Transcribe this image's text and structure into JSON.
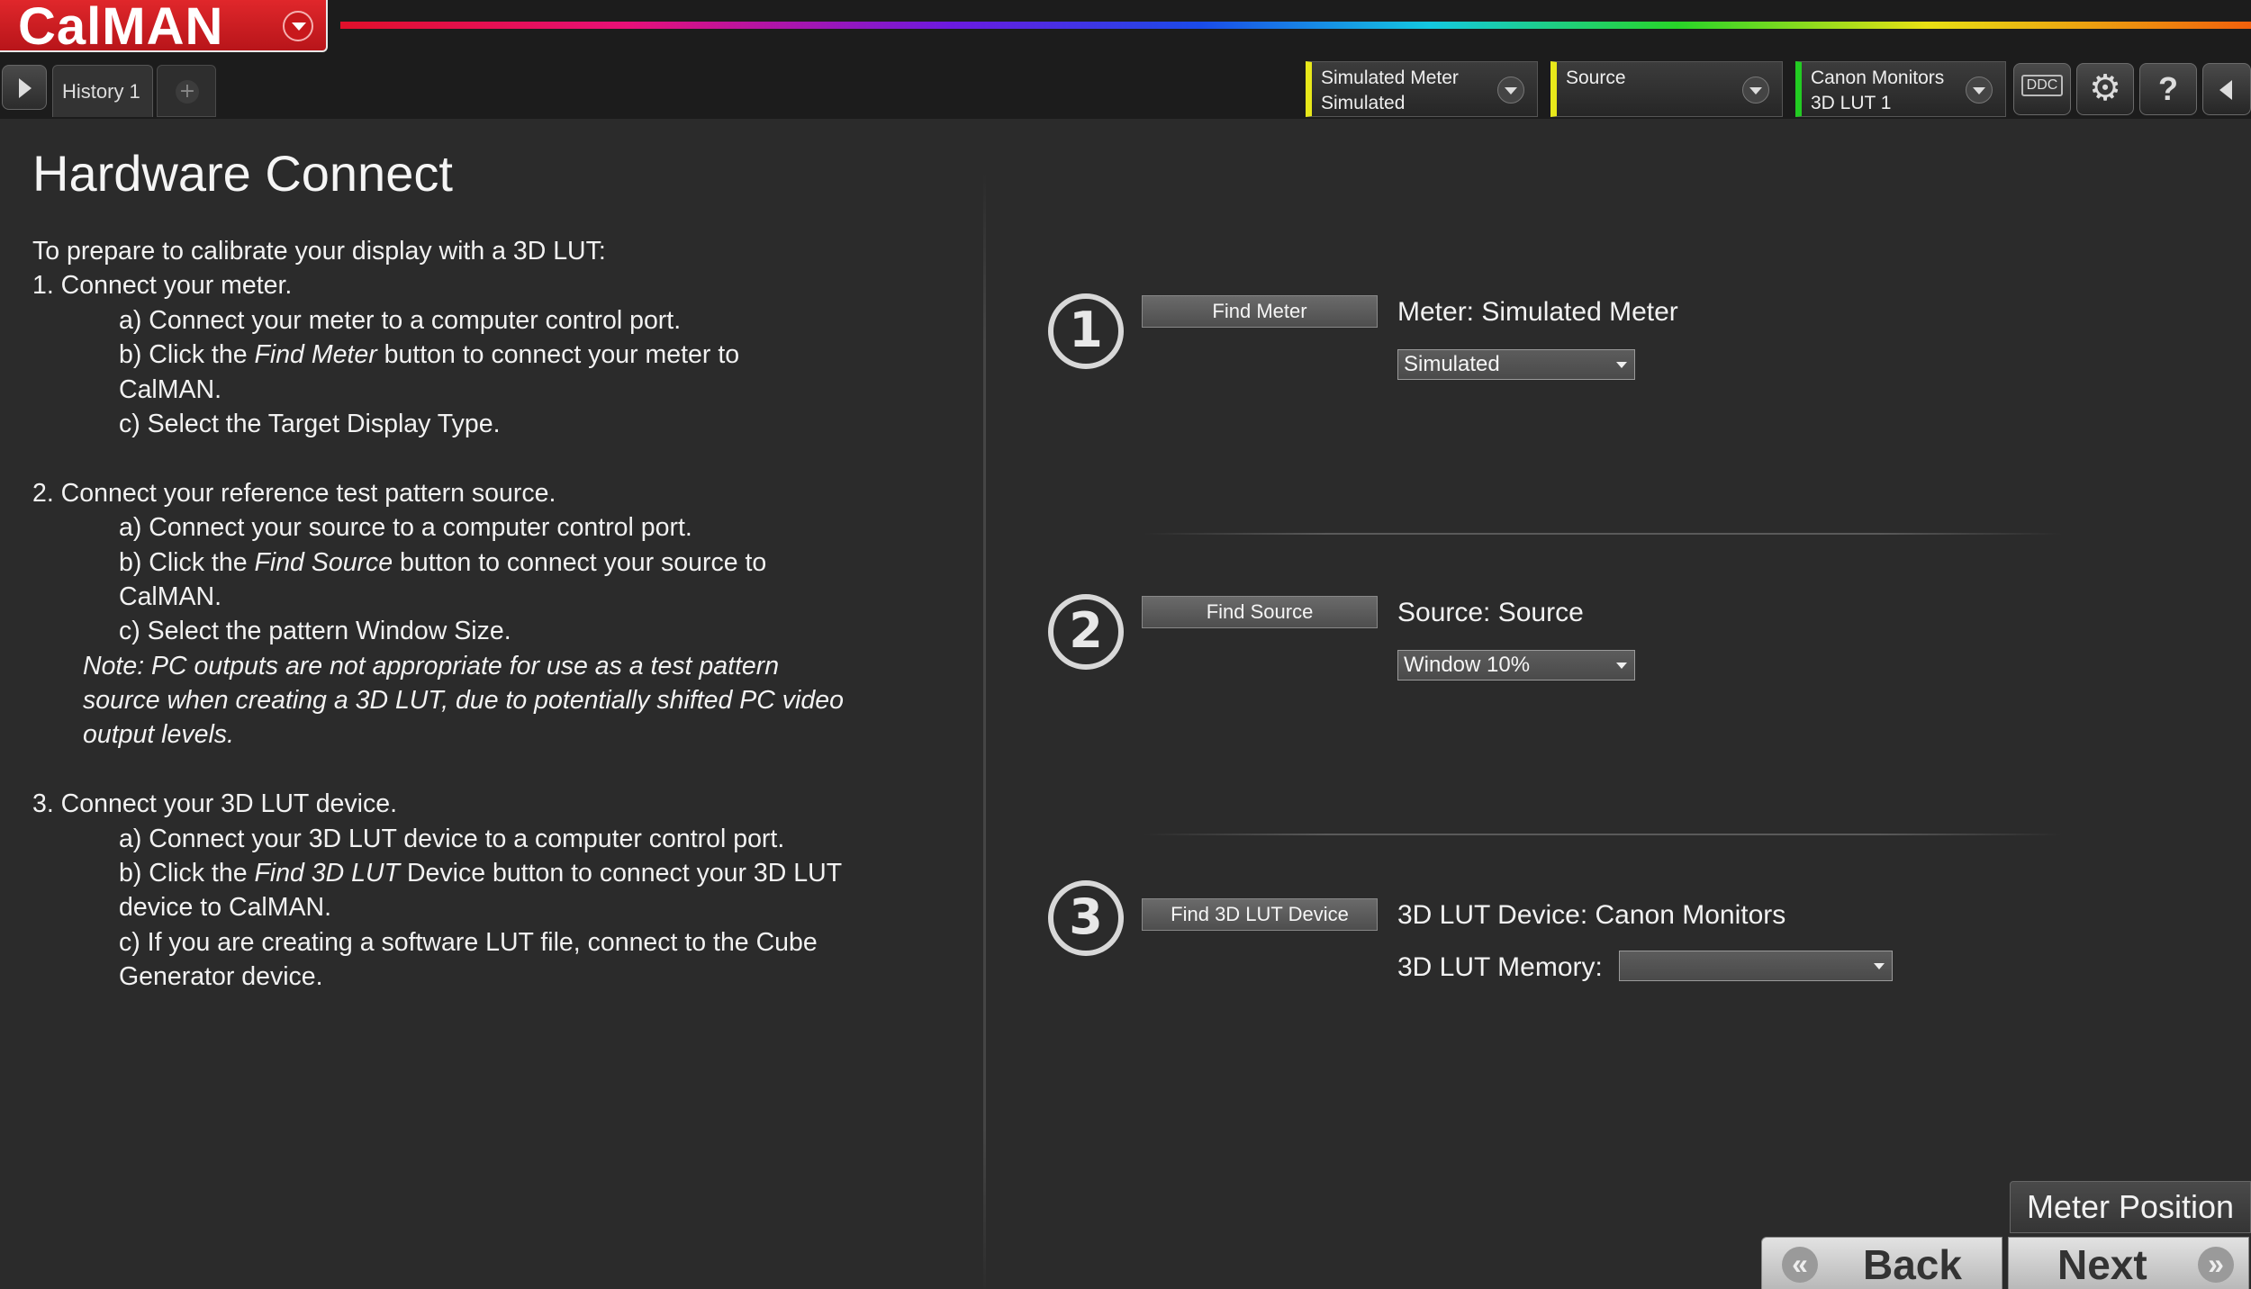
{
  "app": {
    "logo": "CalMAN"
  },
  "tabs": {
    "history": "History 1",
    "add": "+"
  },
  "devices": {
    "meter": {
      "line1": "Simulated Meter",
      "line2": "Simulated",
      "status_color": "#e8e81a"
    },
    "source": {
      "line1": "Source",
      "line2": "",
      "status_color": "#e8e81a"
    },
    "lut": {
      "line1": "Canon Monitors",
      "line2": "3D LUT 1",
      "status_color": "#22cc22"
    }
  },
  "toolbar": {
    "ddc": "DDC",
    "gear": "⚙",
    "help": "?"
  },
  "page": {
    "title": "Hardware Connect"
  },
  "instructions": {
    "intro": "To prepare to calibrate your display with a 3D LUT:",
    "s1": {
      "title": "1.  Connect your meter.",
      "a": "a)  Connect your meter to a computer control port.",
      "b_pre": "b)  Click the ",
      "b_em": "Find Meter",
      "b_post": " button to connect your meter to",
      "b_cont": "CalMAN.",
      "c": "c)  Select the Target Display Type."
    },
    "s2": {
      "title": "2.  Connect your reference test pattern source.",
      "a": "a)  Connect your source to a computer control port.",
      "b_pre": "b)  Click the ",
      "b_em": "Find Source",
      "b_post": " button to connect your source to",
      "b_cont": "CalMAN.",
      "c": "c)  Select the pattern Window Size.",
      "note1": "Note: PC outputs are not appropriate for use as a test pattern",
      "note2": "source when creating a 3D LUT, due to potentially shifted PC video",
      "note3": "output levels."
    },
    "s3": {
      "title": "3.  Connect your 3D LUT device.",
      "a": "a)  Connect your 3D LUT device to a computer control port.",
      "b_pre": "b)  Click the ",
      "b_em": "Find 3D LUT",
      "b_post": " Device button to connect your 3D LUT",
      "b_cont": "device to CalMAN.",
      "c1": "c)  If you are creating a software LUT file, connect to the Cube",
      "c2": "Generator device."
    }
  },
  "steps": {
    "meter": {
      "num": "1",
      "button": "Find Meter",
      "label": "Meter: Simulated Meter",
      "select": "Simulated"
    },
    "source": {
      "num": "2",
      "button": "Find Source",
      "label": "Source: Source",
      "select": "Window 10%"
    },
    "lut": {
      "num": "3",
      "button": "Find 3D LUT Device",
      "label": "3D LUT Device: Canon Monitors",
      "memory_label": "3D LUT Memory:",
      "memory_select": ""
    }
  },
  "nav": {
    "meter_position": "Meter Position",
    "back": "Back",
    "next": "Next",
    "back_icon": "«",
    "next_icon": "»"
  }
}
